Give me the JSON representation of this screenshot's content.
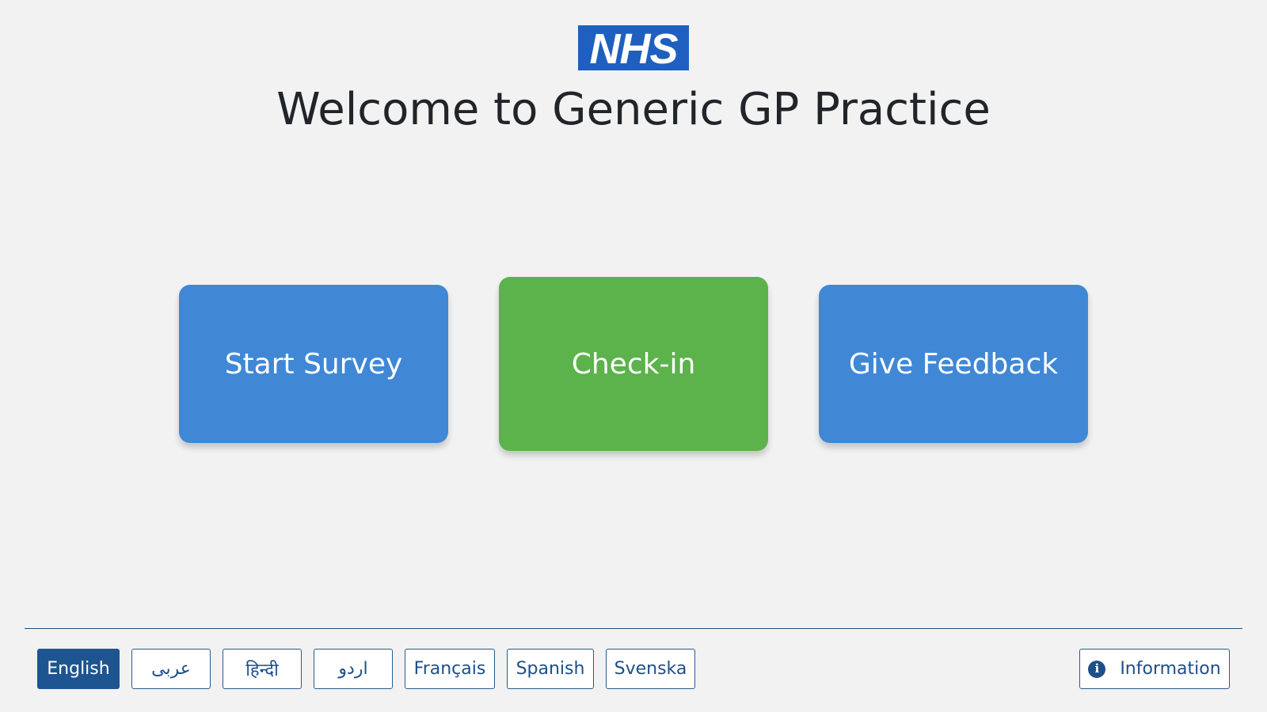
{
  "header": {
    "logo_text": "NHS",
    "title": "Welcome to Generic GP Practice"
  },
  "actions": {
    "start_survey": "Start Survey",
    "check_in": "Check-in",
    "give_feedback": "Give Feedback"
  },
  "languages": [
    {
      "label": "English",
      "selected": true
    },
    {
      "label": "عربى",
      "selected": false
    },
    {
      "label": "हिन्दी",
      "selected": false
    },
    {
      "label": "اردو",
      "selected": false
    },
    {
      "label": "Français",
      "selected": false
    },
    {
      "label": "Spanish",
      "selected": false
    },
    {
      "label": "Svenska",
      "selected": false
    }
  ],
  "footer": {
    "info_label": "Information",
    "info_icon": "info-icon"
  },
  "colors": {
    "nhs_blue": "#1f5fbf",
    "action_blue": "#4088d6",
    "action_green": "#5cb24b",
    "footer_blue": "#1d5590",
    "background": "#f2f2f2"
  }
}
